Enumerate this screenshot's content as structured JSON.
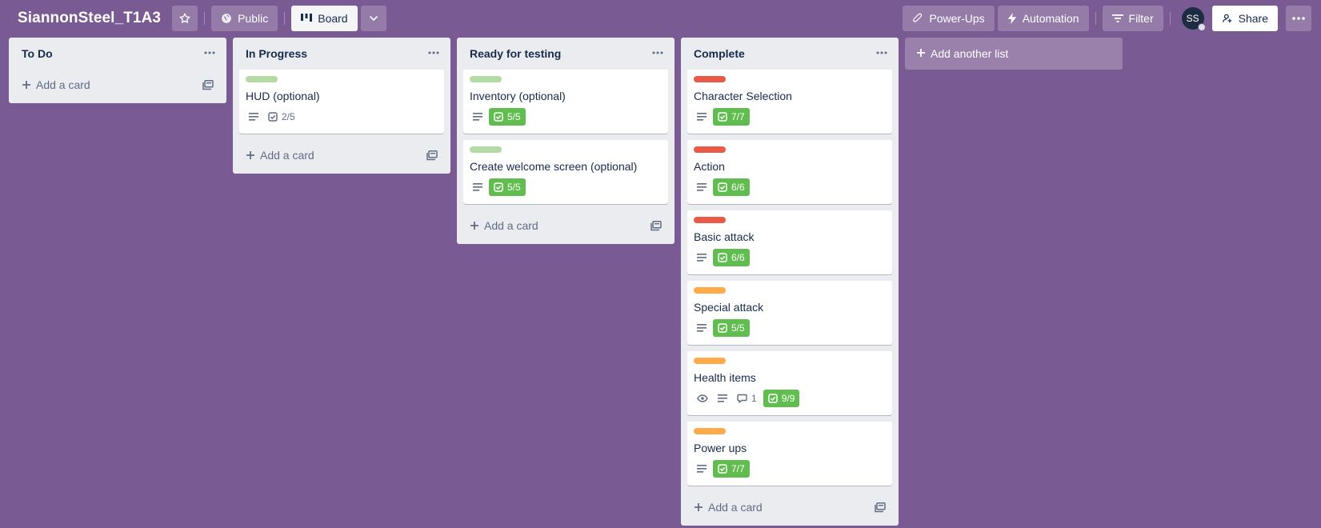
{
  "header": {
    "board_title": "SiannonSteel_T1A3",
    "visibility_label": "Public",
    "view_label": "Board",
    "powerups_label": "Power-Ups",
    "automation_label": "Automation",
    "filter_label": "Filter",
    "avatar_initials": "SS",
    "share_label": "Share"
  },
  "colors": {
    "board_bg": "#7a5a93",
    "label_green": "#b3dba3",
    "label_red": "#eb5a46",
    "label_orange": "#ffab4a",
    "badge_done": "#61bd4f"
  },
  "lists": [
    {
      "title": "To Do",
      "add_card_label": "Add a card",
      "cards": []
    },
    {
      "title": "In Progress",
      "add_card_label": "Add a card",
      "cards": [
        {
          "label": "green",
          "title": "HUD (optional)",
          "description": true,
          "checklist": "2/5",
          "checklist_done": false
        }
      ]
    },
    {
      "title": "Ready for testing",
      "add_card_label": "Add a card",
      "cards": [
        {
          "label": "green",
          "title": "Inventory (optional)",
          "description": true,
          "checklist": "5/5",
          "checklist_done": true
        },
        {
          "label": "green",
          "title": "Create welcome screen (optional)",
          "description": true,
          "checklist": "5/5",
          "checklist_done": true
        }
      ]
    },
    {
      "title": "Complete",
      "add_card_label": "Add a card",
      "cards": [
        {
          "label": "red",
          "title": "Character Selection",
          "description": true,
          "checklist": "7/7",
          "checklist_done": true
        },
        {
          "label": "red",
          "title": "Action",
          "description": true,
          "checklist": "6/6",
          "checklist_done": true
        },
        {
          "label": "red",
          "title": "Basic attack",
          "description": true,
          "checklist": "6/6",
          "checklist_done": true
        },
        {
          "label": "orange",
          "title": "Special attack",
          "description": true,
          "checklist": "5/5",
          "checklist_done": true
        },
        {
          "label": "orange",
          "title": "Health items",
          "watching": true,
          "description": true,
          "comments": "1",
          "checklist": "9/9",
          "checklist_done": true
        },
        {
          "label": "orange",
          "title": "Power ups",
          "description": true,
          "checklist": "7/7",
          "checklist_done": true
        }
      ]
    }
  ],
  "add_list_label": "Add another list",
  "icons": [
    "star-icon",
    "globe-icon",
    "board-icon",
    "chevron-down-icon",
    "rocket-icon",
    "bolt-icon",
    "filter-icon",
    "share-icon",
    "more-icon",
    "list-menu-icon",
    "plus-icon",
    "template-icon",
    "description-icon",
    "checklist-icon",
    "eye-icon",
    "comment-icon"
  ]
}
